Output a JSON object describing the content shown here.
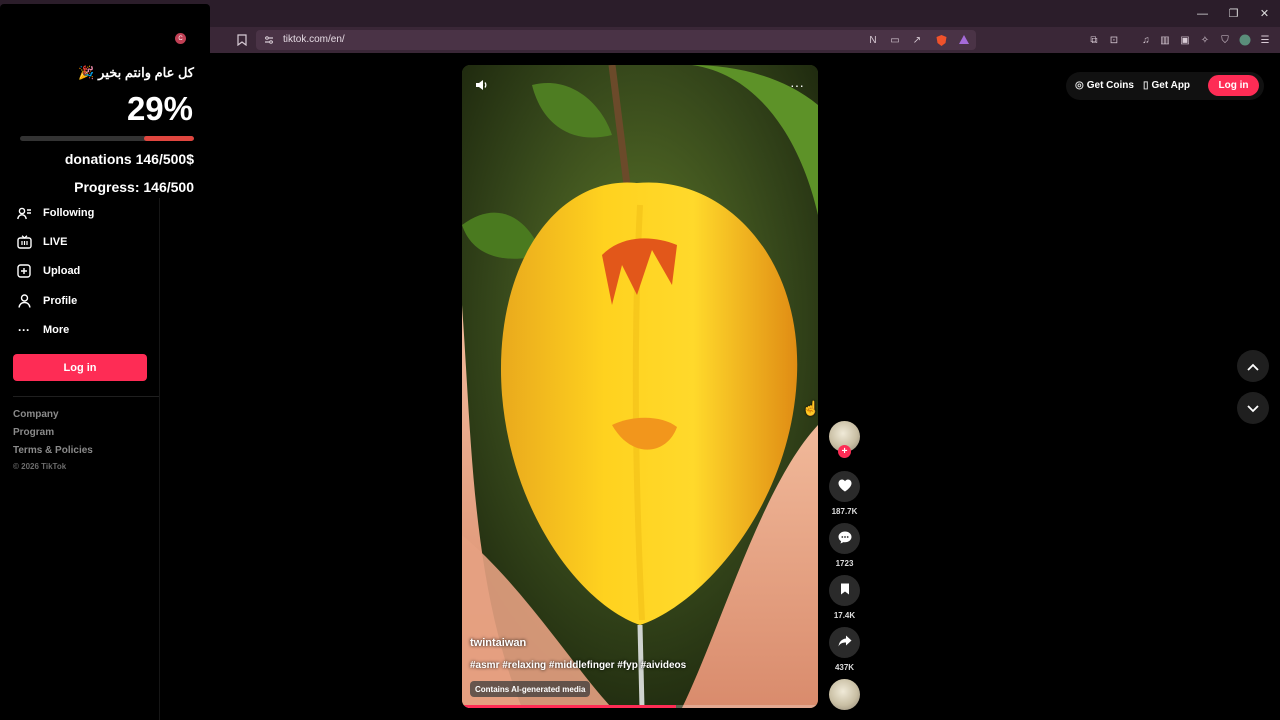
{
  "browser": {
    "url": "tiktok.com/en/",
    "window_controls": {
      "minimize": "—",
      "restore": "❐",
      "close": "✕"
    }
  },
  "donation": {
    "heading": "كل عام وانتم بخير 🎉",
    "percent": "29%",
    "progress_fraction": 0.29,
    "amount_text": "donations 146/500$",
    "progress_text": "Progress: 146/500",
    "colors": {
      "fill": "#e0463f"
    }
  },
  "sidebar": {
    "items": [
      {
        "label": "Following",
        "icon": "following-icon"
      },
      {
        "label": "LIVE",
        "icon": "live-icon"
      },
      {
        "label": "Upload",
        "icon": "upload-icon"
      },
      {
        "label": "Profile",
        "icon": "profile-icon"
      },
      {
        "label": "More",
        "icon": "more-icon"
      }
    ],
    "login_label": "Log in",
    "footer": [
      "Company",
      "Program",
      "Terms & Policies"
    ],
    "copyright": "© 2026 TikTok"
  },
  "header": {
    "get_coins": "Get Coins",
    "get_app": "Get App",
    "login": "Log in"
  },
  "video": {
    "username": "twintaiwan",
    "hashtags": "#asmr #relaxing #middlefinger #fyp #aivideos",
    "badge": "Contains AI-generated media",
    "progress_fraction": 0.6
  },
  "actions": {
    "likes": "187.7K",
    "comments": "1723",
    "saves": "17.4K",
    "shares": "437K"
  },
  "colors": {
    "brand": "#fe2c55",
    "browser_chrome": "#3a2737"
  }
}
